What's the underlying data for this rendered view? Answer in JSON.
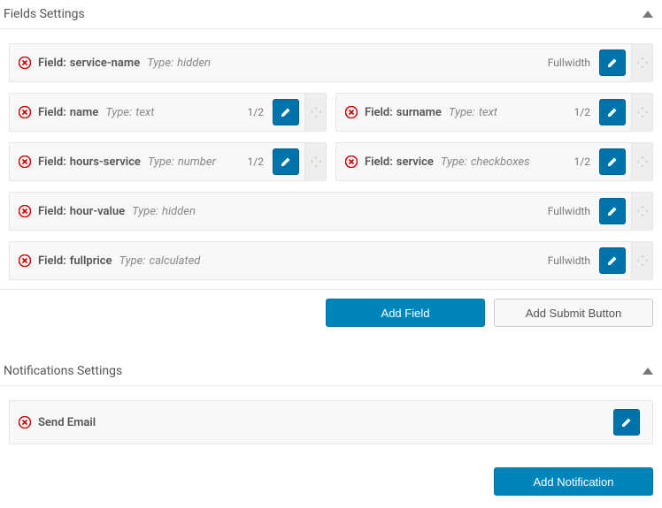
{
  "sections": {
    "fields": {
      "title": "Fields Settings"
    },
    "notifications": {
      "title": "Notifications Settings"
    }
  },
  "labels": {
    "field_prefix": "Field:",
    "type_prefix": "Type:"
  },
  "widths": {
    "full": "Fullwidth",
    "half": "1/2"
  },
  "fields": [
    {
      "name": "service-name",
      "type": "hidden",
      "width": "full"
    },
    {
      "name": "name",
      "type": "text",
      "width": "half"
    },
    {
      "name": "surname",
      "type": "text",
      "width": "half"
    },
    {
      "name": "hours-service",
      "type": "number",
      "width": "half"
    },
    {
      "name": "service",
      "type": "checkboxes",
      "width": "half"
    },
    {
      "name": "hour-value",
      "type": "hidden",
      "width": "full"
    },
    {
      "name": "fullprice",
      "type": "calculated",
      "width": "full"
    }
  ],
  "notifications": [
    {
      "label": "Send Email"
    }
  ],
  "buttons": {
    "add_field": "Add Field",
    "add_submit": "Add Submit Button",
    "add_notification": "Add Notification"
  }
}
